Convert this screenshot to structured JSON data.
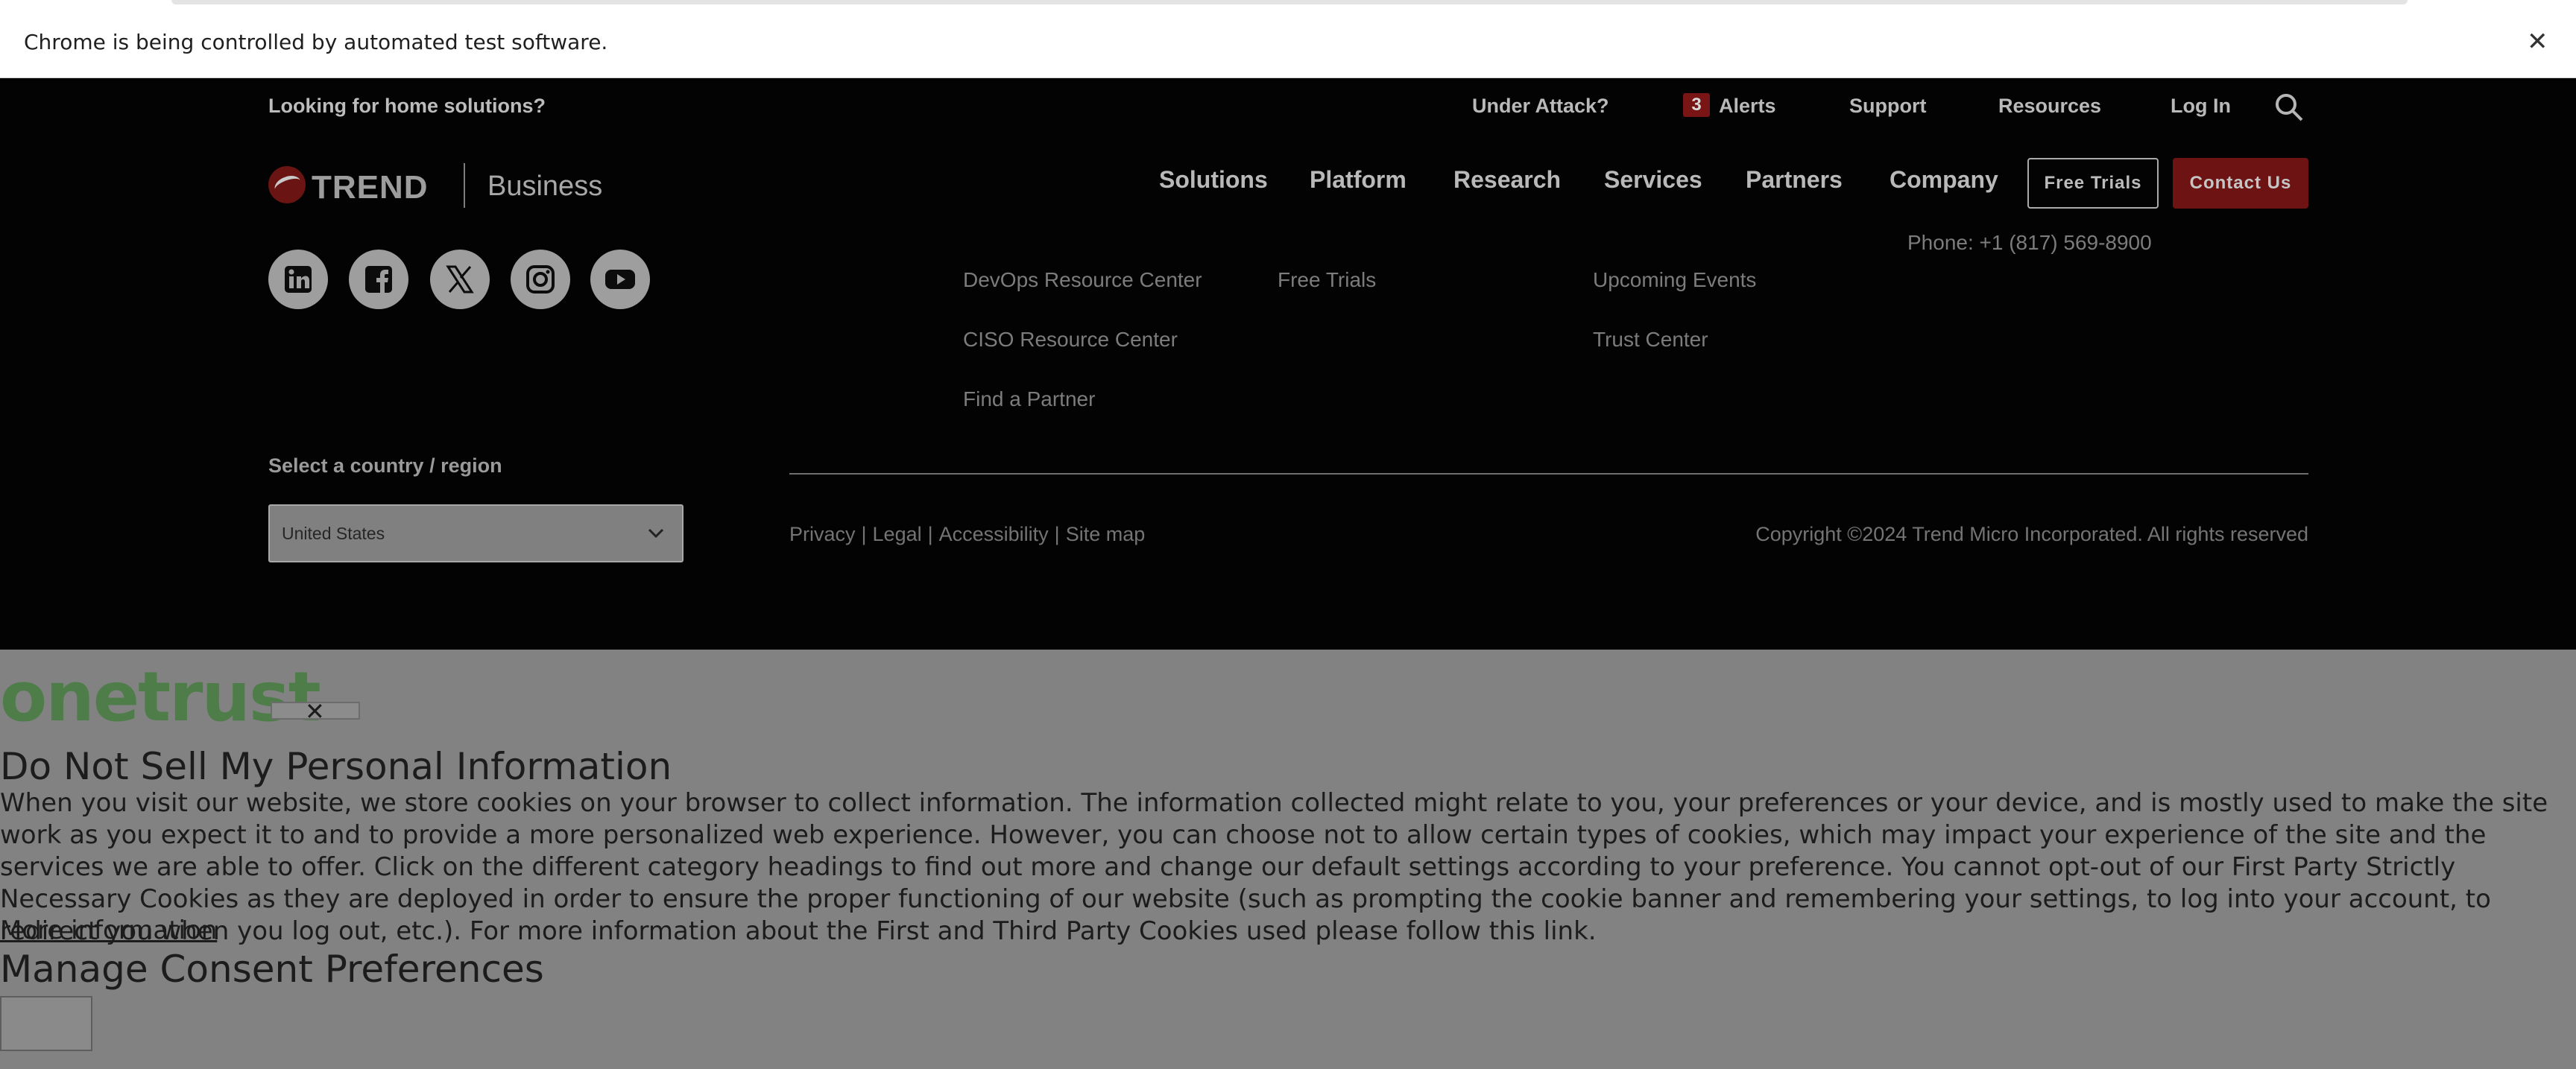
{
  "browser": {
    "automation_message": "Chrome is being controlled by automated test software.",
    "close_glyph": "✕"
  },
  "utility_nav": {
    "home_prompt": "Looking for home solutions?",
    "under_attack": "Under Attack?",
    "alerts_count": "3",
    "alerts_label": "Alerts",
    "support": "Support",
    "resources": "Resources",
    "login": "Log In",
    "search_icon": "search-icon"
  },
  "brand": {
    "name": "TREND",
    "division": "Business",
    "accent_color": "#d71920"
  },
  "main_nav": {
    "items": [
      "Solutions",
      "Platform",
      "Research",
      "Services",
      "Partners",
      "Company"
    ],
    "free_trials": "Free Trials",
    "contact_us": "Contact Us"
  },
  "social": [
    "linkedin-icon",
    "facebook-icon",
    "x-icon",
    "instagram-icon",
    "youtube-icon"
  ],
  "footer_links": {
    "col1": [
      "DevOps Resource Center",
      "CISO Resource Center",
      "Find a Partner"
    ],
    "col2": [
      "Free Trials"
    ],
    "col3": [
      "Upcoming Events",
      "Trust Center"
    ],
    "phone": "Phone: +1 (817) 569-8900"
  },
  "region": {
    "label": "Select a country / region",
    "selected": "United States"
  },
  "legal": {
    "links": [
      "Privacy",
      "Legal",
      "Accessibility",
      "Site map"
    ],
    "separator": "|",
    "copyright": "Copyright ©2024 Trend Micro Incorporated. All rights reserved"
  },
  "onetrust": {
    "logo": "onetrust",
    "close_glyph": "✕",
    "title": "Do Not Sell My Personal Information",
    "body": "When you visit our website, we store cookies on your browser to collect information. The information collected might relate to you, your preferences or your device, and is mostly used to make the site work as you expect it to and to provide a more personalized web experience. However, you can choose not to allow certain types of cookies, which may impact your experience of the site and the services we are able to offer. Click on the different category headings to find out more and change our default settings according to your preference. You cannot opt-out of our First Party Strictly Necessary Cookies as they are deployed in order to ensure the proper functioning of our website (such as prompting the cookie banner and remembering your settings, to log into your account, to redirect you when you log out, etc.). For more information about the First and Third Party Cookies used please follow this link.",
    "more_info": "More information",
    "manage_heading": "Manage Consent Preferences"
  }
}
